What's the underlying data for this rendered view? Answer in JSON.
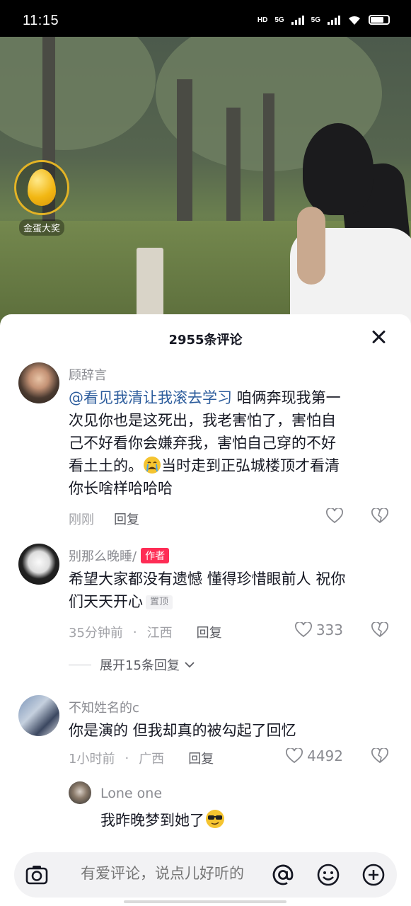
{
  "status_bar": {
    "time": "11:15",
    "network1": "5G",
    "network2": "5G",
    "hd_label": "HD"
  },
  "video": {
    "egg_label": "金蛋大奖"
  },
  "comments_sheet": {
    "count_label": "2955条评论",
    "comments": [
      {
        "author": "顾辞言",
        "mention": "@看见我清让我滚去学习",
        "text_line1": " 咱俩奔现我第一",
        "text_line2": "次见你也是这死出，我老害怕了，害怕自",
        "text_line3": "己不好看你会嫌弃我，害怕自己穿的不好",
        "text_line4a": "看土土的。",
        "text_line4b": "当时走到正弘城楼顶才看清",
        "text_line5": "你长啥样哈哈哈",
        "time": "刚刚",
        "reply_label": "回复"
      },
      {
        "author": "别那么晚睡/",
        "author_badge": "作者",
        "text_line1": "希望大家都没有遗憾 懂得珍惜眼前人 祝你",
        "text_line2": "们天天开心",
        "pin_label": "置顶",
        "time": "35分钟前",
        "location": "江西",
        "reply_label": "回复",
        "likes": "333",
        "expand_label": "展开15条回复"
      },
      {
        "author": "不知姓名的c",
        "text": "你是演的 但我却真的被勾起了回忆",
        "time": "1小时前",
        "location": "广西",
        "reply_label": "回复",
        "likes": "4492"
      }
    ],
    "sub_reply": {
      "author": "Lone one",
      "text": "我昨晚梦到她了"
    }
  },
  "input_bar": {
    "placeholder": "有爱评论，说点儿好听的"
  },
  "colors": {
    "accent": "#fe2c55",
    "mention": "#2c5c9c",
    "text": "#161823",
    "muted": "#a1a2a7"
  }
}
